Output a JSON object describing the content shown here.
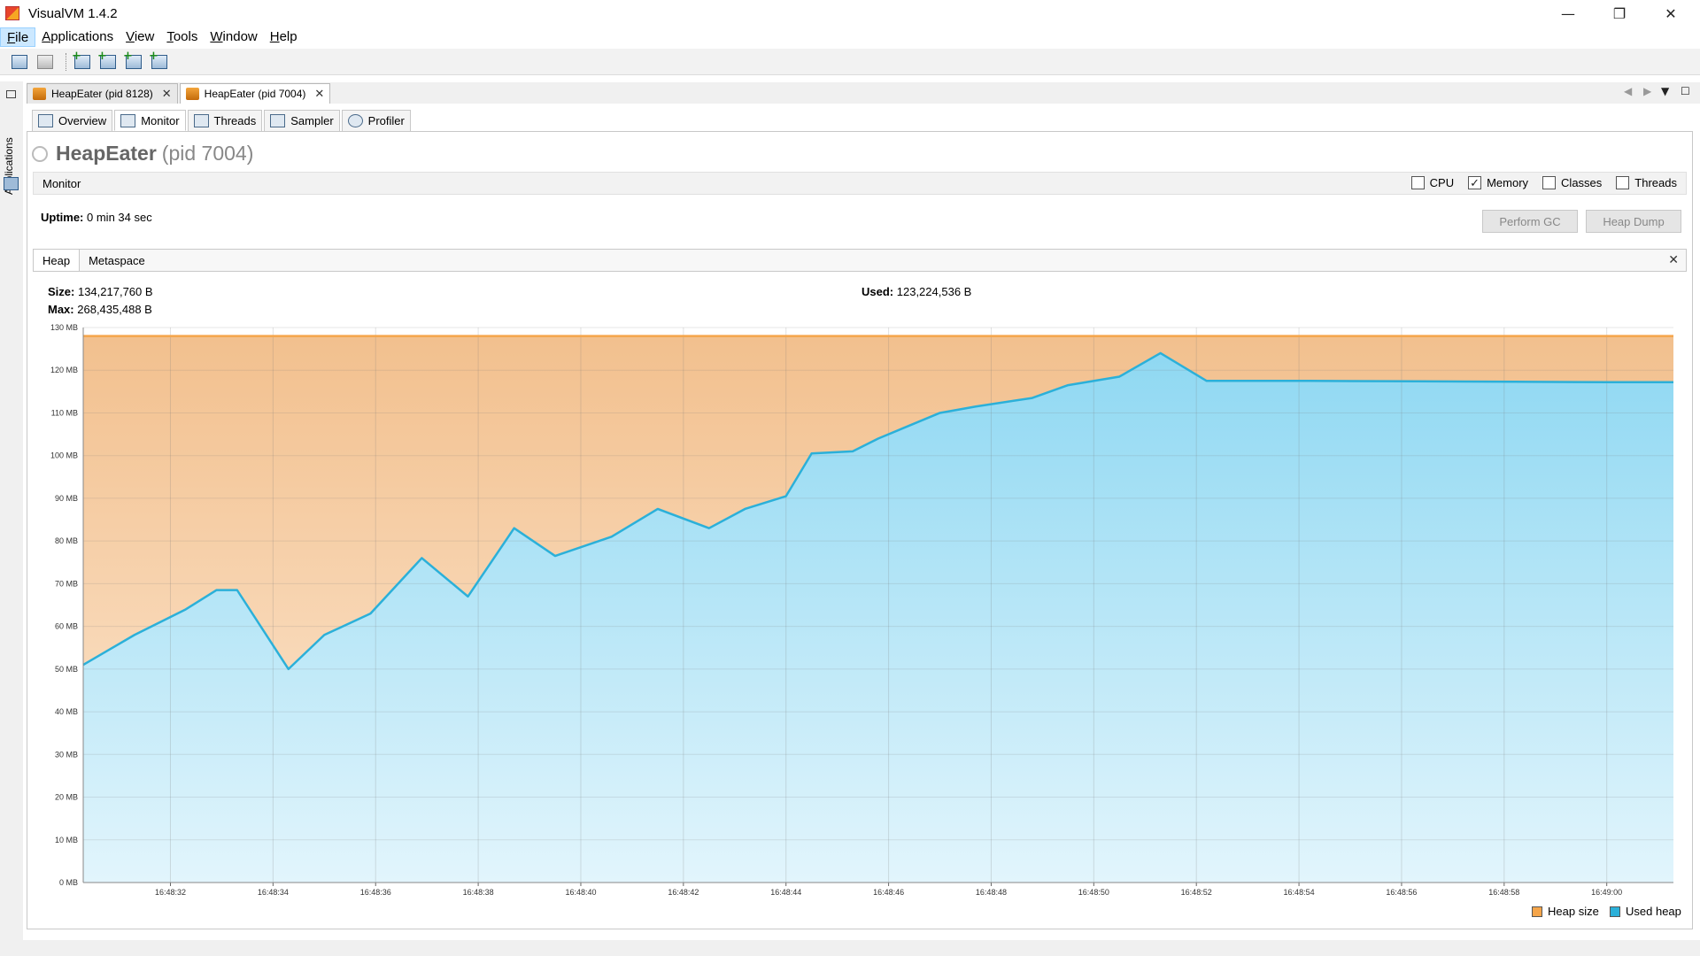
{
  "window": {
    "title": "VisualVM 1.4.2",
    "controls": {
      "minimize": "—",
      "restore": "❐",
      "close": "✕"
    }
  },
  "menu": {
    "items": [
      {
        "label": "File",
        "mnemonic": "F",
        "rest": "ile"
      },
      {
        "label": "Applications",
        "mnemonic": "A",
        "rest": "pplications"
      },
      {
        "label": "View",
        "mnemonic": "V",
        "rest": "iew"
      },
      {
        "label": "Tools",
        "mnemonic": "T",
        "rest": "ools"
      },
      {
        "label": "Window",
        "mnemonic": "W",
        "rest": "indow"
      },
      {
        "label": "Help",
        "mnemonic": "H",
        "rest": "elp"
      }
    ]
  },
  "sidebar": {
    "label": "Applications"
  },
  "doc_tabs": [
    {
      "label": "HeapEater (pid 8128)",
      "active": false
    },
    {
      "label": "HeapEater (pid 7004)",
      "active": true
    }
  ],
  "view_tabs": [
    {
      "label": "Overview"
    },
    {
      "label": "Monitor"
    },
    {
      "label": "Threads"
    },
    {
      "label": "Sampler"
    },
    {
      "label": "Profiler"
    }
  ],
  "process": {
    "name": "HeapEater",
    "pid": "(pid 7004)"
  },
  "monitor": {
    "label": "Monitor",
    "checks": [
      {
        "label": "CPU",
        "checked": false
      },
      {
        "label": "Memory",
        "checked": true
      },
      {
        "label": "Classes",
        "checked": false
      },
      {
        "label": "Threads",
        "checked": false
      }
    ]
  },
  "uptime": {
    "label": "Uptime:",
    "value": "0 min 34 sec"
  },
  "buttons": {
    "perform_gc": "Perform GC",
    "heap_dump": "Heap Dump"
  },
  "sub_tabs": {
    "heap": "Heap",
    "metaspace": "Metaspace",
    "close": "✕"
  },
  "stats": {
    "size_label": "Size:",
    "size_value": "134,217,760 B",
    "max_label": "Max:",
    "max_value": "268,435,488 B",
    "used_label": "Used:",
    "used_value": "123,224,536 B"
  },
  "colors": {
    "heap_size": "#f5a54a",
    "used_heap": "#2bb0d9"
  },
  "chart_data": {
    "type": "area",
    "ylim": [
      0,
      130
    ],
    "y_ticks": [
      "0 MB",
      "10 MB",
      "20 MB",
      "30 MB",
      "40 MB",
      "50 MB",
      "60 MB",
      "70 MB",
      "80 MB",
      "90 MB",
      "100 MB",
      "110 MB",
      "120 MB",
      "130 MB"
    ],
    "x_ticks": [
      "16:48:32",
      "16:48:34",
      "16:48:36",
      "16:48:38",
      "16:48:40",
      "16:48:42",
      "16:48:44",
      "16:48:46",
      "16:48:48",
      "16:48:50",
      "16:48:52",
      "16:48:54",
      "16:48:56",
      "16:48:58",
      "16:49:00"
    ],
    "series": [
      {
        "name": "Heap size",
        "x": [
          30.3,
          49.5
        ],
        "values": [
          128,
          128
        ]
      },
      {
        "name": "Used heap",
        "x": [
          30.3,
          31.3,
          32.3,
          32.9,
          33.3,
          34.3,
          35.0,
          35.9,
          36.9,
          37.8,
          38.7,
          39.5,
          40.6,
          41.5,
          42.5,
          43.2,
          44.0,
          44.5,
          45.3,
          45.8,
          47.0,
          47.7,
          48.8,
          49.5,
          50.5,
          51.3,
          52.2,
          53.2,
          54.2,
          56.3,
          58.2,
          60.0,
          61.3
        ],
        "values": [
          51,
          58,
          64,
          68.5,
          68.5,
          50,
          58,
          63,
          76,
          67,
          83,
          76.5,
          81,
          87.5,
          83,
          87.5,
          90.5,
          100.5,
          101,
          104,
          110,
          111.5,
          113.5,
          116.5,
          118.5,
          124,
          117.5,
          117.5,
          117.5,
          117.4,
          117.3,
          117.2,
          117.2
        ]
      }
    ],
    "legend": [
      "Heap size",
      "Used heap"
    ],
    "legend_position": "bottom-right",
    "grid": true
  }
}
